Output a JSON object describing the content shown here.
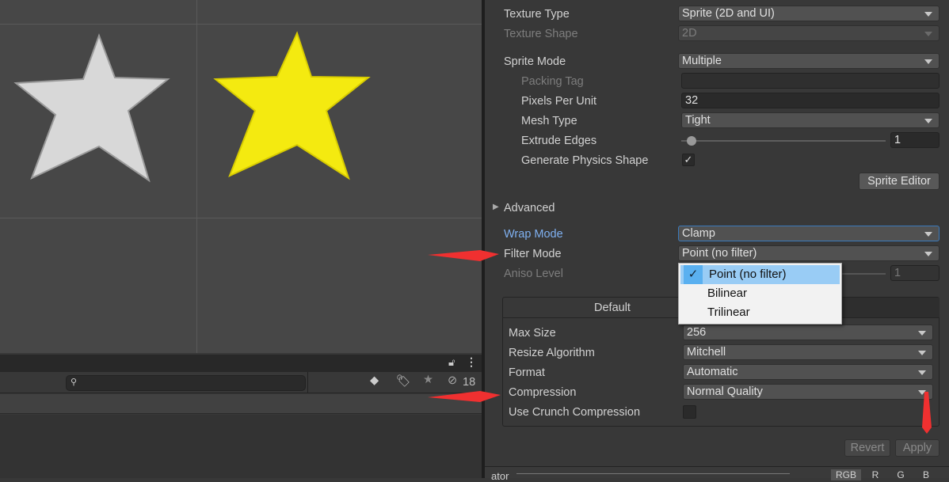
{
  "project": {
    "search_placeholder": "",
    "hidden_count": "18",
    "icons": [
      "lock-icon",
      "more-icon",
      "search-icon",
      "type-filter-icon",
      "label-filter-icon",
      "favorite-icon",
      "hidden-eye-icon"
    ]
  },
  "inspector": {
    "texture_type": {
      "label": "Texture Type",
      "value": "Sprite (2D and UI)"
    },
    "texture_shape": {
      "label": "Texture Shape",
      "value": "2D"
    },
    "sprite_mode": {
      "label": "Sprite Mode",
      "value": "Multiple"
    },
    "packing_tag": {
      "label": "Packing Tag",
      "value": ""
    },
    "pixels_per_unit": {
      "label": "Pixels Per Unit",
      "value": "32"
    },
    "mesh_type": {
      "label": "Mesh Type",
      "value": "Tight"
    },
    "extrude_edges": {
      "label": "Extrude Edges",
      "value": "1",
      "slider_fraction": 0.04
    },
    "generate_physics": {
      "label": "Generate Physics Shape",
      "checked": true
    },
    "sprite_editor": "Sprite Editor",
    "advanced": "Advanced",
    "wrap_mode": {
      "label": "Wrap Mode",
      "value": "Clamp"
    },
    "filter_mode": {
      "label": "Filter Mode",
      "value": "Point (no filter)",
      "options": [
        "Point (no filter)",
        "Bilinear",
        "Trilinear"
      ]
    },
    "aniso_level": {
      "label": "Aniso Level",
      "value": "1"
    },
    "platform_tab": "Default",
    "max_size": {
      "label": "Max Size",
      "value": "256"
    },
    "resize_algorithm": {
      "label": "Resize Algorithm",
      "value": "Mitchell"
    },
    "format": {
      "label": "Format",
      "value": "Automatic"
    },
    "compression": {
      "label": "Compression",
      "value": "Normal Quality"
    },
    "crunch": {
      "label": "Use Crunch Compression",
      "checked": false
    },
    "revert": "Revert",
    "apply": "Apply",
    "preview_label": "ator",
    "channels": [
      "RGB",
      "R",
      "G",
      "B"
    ]
  },
  "colors": {
    "accent": "#3a79bb",
    "annotation_arrow": "#f03030",
    "star_yellow": "#f4ea10"
  }
}
